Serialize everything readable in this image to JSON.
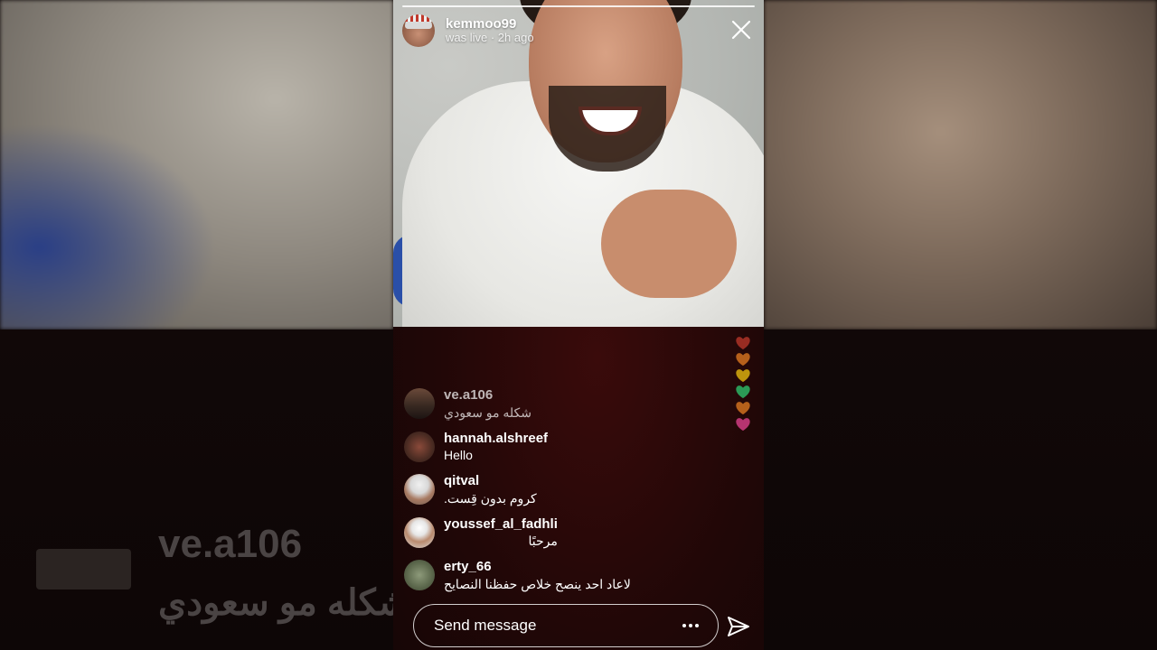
{
  "live": {
    "username": "kemmoo99",
    "status": "was live · 2h ago"
  },
  "comments": [
    {
      "user": "ve.a106",
      "text": "شكله مو سعودي"
    },
    {
      "user": "hannah.alshreef",
      "text": "Hello"
    },
    {
      "user": "qitval",
      "text": "كروم بدون قِست."
    },
    {
      "user": "youssef_al_fadhli",
      "text": "مرحبًا"
    },
    {
      "user": "erty_66",
      "text": "لاعاد احد ينصح خلاص حفظنا النصايح"
    }
  ],
  "composer": {
    "placeholder": "Send message"
  },
  "backdrop": {
    "ghost_user": "ve.a106",
    "ghost_comment": "شكله مو سعودي"
  },
  "colors": {
    "accent": "#ffffff",
    "background": "#1a0707"
  },
  "icons": [
    "close-icon",
    "more-options-icon",
    "send-icon",
    "heart-icon"
  ]
}
